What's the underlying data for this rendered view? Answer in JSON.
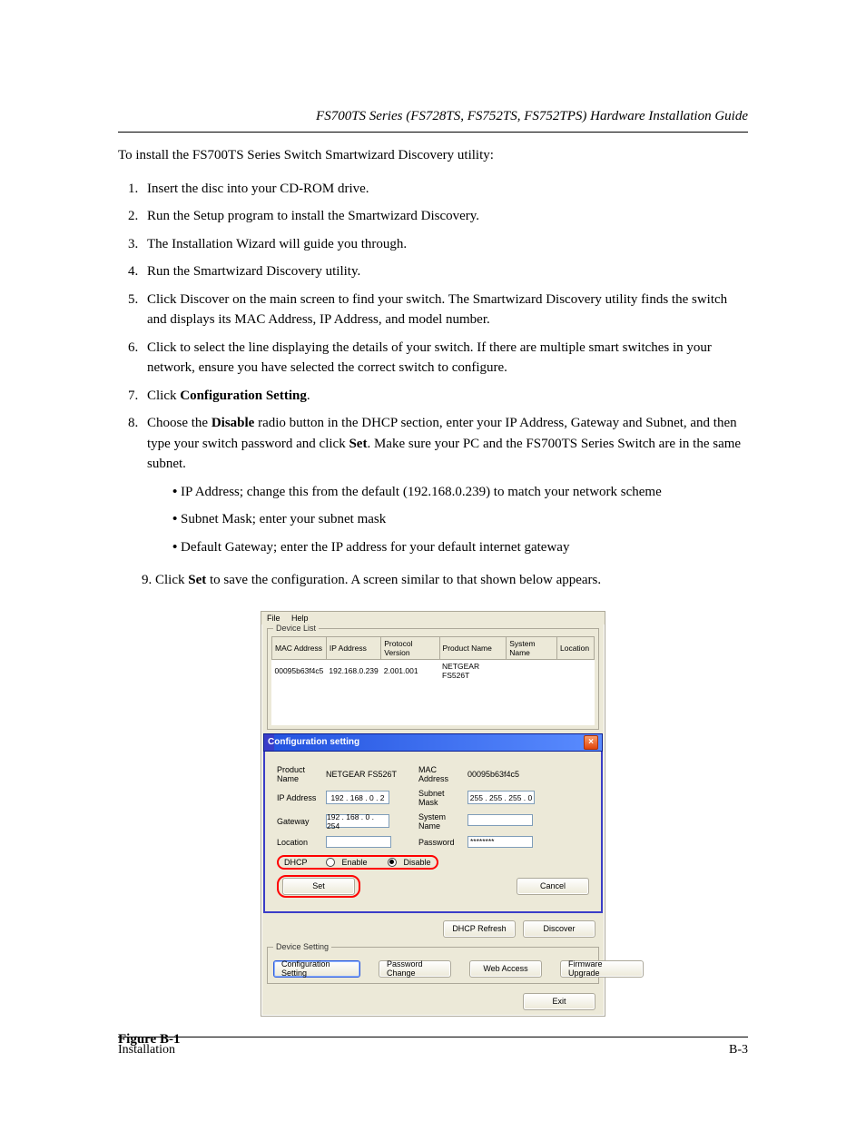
{
  "running_head_left": "FS700TS Series (FS728TS, FS752TS, FS752TPS) Hardware Installation Guide",
  "intro": "To install the FS700TS Series Switch Smartwizard Discovery utility:",
  "steps": [
    "Insert the disc into your CD-ROM drive.",
    "Run the Setup program to install the Smartwizard Discovery.",
    "The Installation Wizard will guide you through.",
    "Run the Smartwizard Discovery utility.",
    "Click Discover on the main screen to find your switch. The Smartwizard Discovery utility finds the switch and displays its MAC Address, IP Address, and model number.",
    "Click to select the line displaying the details of your switch. If there are multiple smart switches in your network, ensure you have selected the correct switch to configure.",
    "Click Configuration Setting.",
    "Choose the Disable radio button in the DHCP section, enter your IP Address, Gateway and Subnet, and then type your switch password and click Set. Make sure your PC and the FS700TS Series Switch are in the same subnet."
  ],
  "subpoints": [
    "IP Address; change this from the default (192.168.0.239) to match your network scheme",
    "Subnet Mask; enter your subnet mask",
    "Default Gateway; enter the IP address for your default internet gateway"
  ],
  "click_set_bold": "Set",
  "click_set_rest": " to save the configuration. A screen similar to that shown below appears.",
  "step9_num": "9.",
  "figure_caption": "Figure B-1",
  "footer_left": "Installation",
  "footer_right": "B-3",
  "screenshot": {
    "menu": {
      "file": "File",
      "help": "Help"
    },
    "devlist_legend": "Device List",
    "headers": [
      "MAC Address",
      "IP Address",
      "Protocol Version",
      "Product Name",
      "System Name",
      "Location"
    ],
    "row": {
      "mac": "00095b63f4c5",
      "ip": "192.168.0.239",
      "proto": "2.001.001",
      "prod": "NETGEAR FS526T",
      "sys": "",
      "loc": ""
    },
    "conf_title": "Configuration setting",
    "labels": {
      "product_name": "Product Name",
      "mac_address": "MAC Address",
      "ip_address": "IP Address",
      "subnet_mask": "Subnet Mask",
      "gateway": "Gateway",
      "system_name": "System Name",
      "location": "Location",
      "password": "Password",
      "dhcp": "DHCP"
    },
    "values": {
      "product_name": "NETGEAR FS526T",
      "mac": "00095b63f4c5",
      "ip": "192 . 168 .   0 .   2",
      "subnet": "255 . 255 . 255 .   0",
      "gateway": "192 . 168 .   0 . 254",
      "location": "",
      "system_name": "",
      "password": "********"
    },
    "radio": {
      "enable": "Enable",
      "disable": "Disable"
    },
    "buttons": {
      "set": "Set",
      "cancel": "Cancel",
      "dhcp_refresh": "DHCP Refresh",
      "discover": "Discover",
      "conf_setting": "Configuration Setting",
      "pwd_change": "Password Change",
      "web_access": "Web Access",
      "fw_upgrade": "Firmware Upgrade",
      "exit": "Exit"
    },
    "devset_legend": "Device Setting"
  }
}
